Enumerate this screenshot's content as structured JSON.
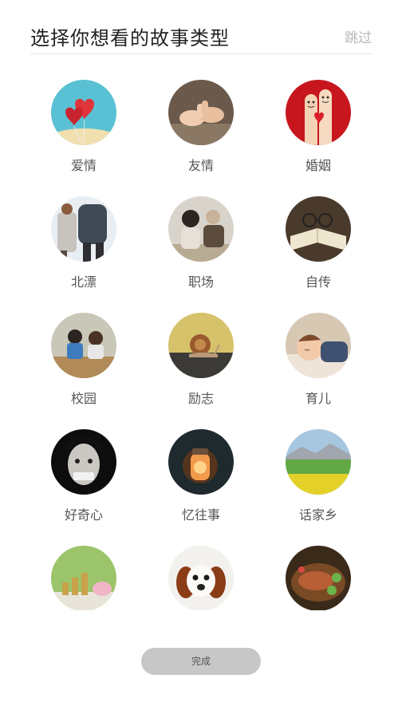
{
  "header": {
    "title": "选择你想看的故事类型",
    "skip_label": "跳过"
  },
  "categories": [
    {
      "label": "爱情",
      "icon": "heart-balloons-icon"
    },
    {
      "label": "友情",
      "icon": "pinky-promise-icon"
    },
    {
      "label": "婚姻",
      "icon": "finger-couple-icon"
    },
    {
      "label": "北漂",
      "icon": "backpackers-icon"
    },
    {
      "label": "职场",
      "icon": "office-colleagues-icon"
    },
    {
      "label": "自传",
      "icon": "open-book-glasses-icon"
    },
    {
      "label": "校园",
      "icon": "students-classroom-icon"
    },
    {
      "label": "励志",
      "icon": "snail-icon"
    },
    {
      "label": "育儿",
      "icon": "sleeping-baby-icon"
    },
    {
      "label": "好奇心",
      "icon": "taped-mouth-face-icon"
    },
    {
      "label": "忆往事",
      "icon": "glowing-jar-icon"
    },
    {
      "label": "话家乡",
      "icon": "meadow-landscape-icon"
    },
    {
      "label": "",
      "icon": "piggy-bank-coins-icon"
    },
    {
      "label": "",
      "icon": "puppy-icon"
    },
    {
      "label": "",
      "icon": "bbq-platter-icon"
    }
  ],
  "footer": {
    "done_label": "完成"
  }
}
